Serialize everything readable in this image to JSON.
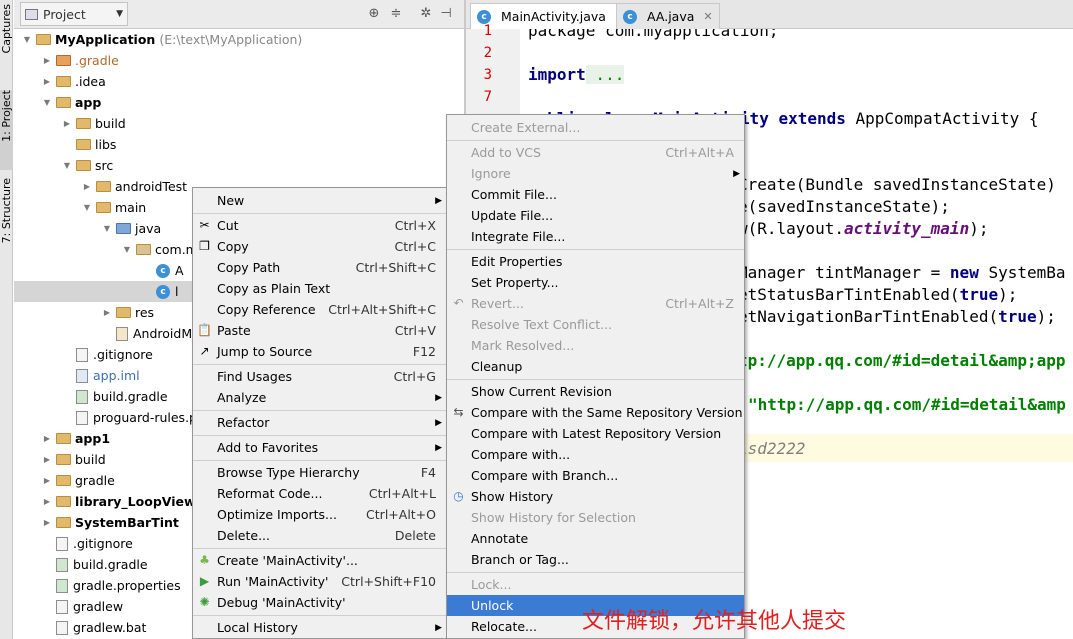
{
  "side_tabs": {
    "captures": "Captures",
    "project": "1: Project",
    "structure": "7: Structure"
  },
  "project_panel": {
    "dropdown_label": "Project"
  },
  "tree": [
    {
      "label": "MyApplication",
      "extra": "(E:\\text\\MyApplication)",
      "depth": 0,
      "arrow": "down",
      "icon": "module",
      "bold": true
    },
    {
      "label": ".gradle",
      "depth": 1,
      "arrow": "right",
      "icon": "folder-red"
    },
    {
      "label": ".idea",
      "depth": 1,
      "arrow": "right",
      "icon": "folder"
    },
    {
      "label": "app",
      "depth": 1,
      "arrow": "down",
      "icon": "module",
      "bold": true
    },
    {
      "label": "build",
      "depth": 2,
      "arrow": "right",
      "icon": "folder"
    },
    {
      "label": "libs",
      "depth": 2,
      "arrow": "",
      "icon": "folder"
    },
    {
      "label": "src",
      "depth": 2,
      "arrow": "down",
      "icon": "folder"
    },
    {
      "label": "androidTest",
      "depth": 3,
      "arrow": "right",
      "icon": "folder"
    },
    {
      "label": "main",
      "depth": 3,
      "arrow": "down",
      "icon": "folder"
    },
    {
      "label": "java",
      "depth": 4,
      "arrow": "down",
      "icon": "folder-src"
    },
    {
      "label": "com.m",
      "depth": 5,
      "arrow": "down",
      "icon": "package"
    },
    {
      "label": "A",
      "depth": 6,
      "arrow": "",
      "icon": "class"
    },
    {
      "label": "l",
      "depth": 6,
      "arrow": "",
      "icon": "class",
      "selected": true
    },
    {
      "label": "res",
      "depth": 4,
      "arrow": "right",
      "icon": "folder-res"
    },
    {
      "label": "AndroidM",
      "depth": 4,
      "arrow": "",
      "icon": "manifest"
    },
    {
      "label": ".gitignore",
      "depth": 2,
      "arrow": "",
      "icon": "file"
    },
    {
      "label": "app.iml",
      "depth": 2,
      "arrow": "",
      "icon": "iml",
      "muted": true
    },
    {
      "label": "build.gradle",
      "depth": 2,
      "arrow": "",
      "icon": "gradle"
    },
    {
      "label": "proguard-rules.p",
      "depth": 2,
      "arrow": "",
      "icon": "file"
    },
    {
      "label": "app1",
      "depth": 1,
      "arrow": "right",
      "icon": "module",
      "bold": true
    },
    {
      "label": "build",
      "depth": 1,
      "arrow": "right",
      "icon": "folder"
    },
    {
      "label": "gradle",
      "depth": 1,
      "arrow": "right",
      "icon": "folder"
    },
    {
      "label": "library_LoopView",
      "depth": 1,
      "arrow": "right",
      "icon": "module",
      "bold": true
    },
    {
      "label": "SystemBarTint",
      "depth": 1,
      "arrow": "right",
      "icon": "module",
      "bold": true
    },
    {
      "label": ".gitignore",
      "depth": 1,
      "arrow": "",
      "icon": "file"
    },
    {
      "label": "build.gradle",
      "depth": 1,
      "arrow": "",
      "icon": "gradle"
    },
    {
      "label": "gradle.properties",
      "depth": 1,
      "arrow": "",
      "icon": "gradle"
    },
    {
      "label": "gradlew",
      "depth": 1,
      "arrow": "",
      "icon": "file"
    },
    {
      "label": "gradlew.bat",
      "depth": 1,
      "arrow": "",
      "icon": "file"
    }
  ],
  "editor_tabs": [
    {
      "label": "MainActivity.java",
      "active": true
    },
    {
      "label": "AA.java",
      "active": false
    }
  ],
  "line_numbers": [
    "1",
    "2",
    "3",
    "7"
  ],
  "code": {
    "l1": "package com.myapplication;",
    "l3a": "import",
    "l3b": " ...",
    "l7a": "public class MainActivity ",
    "l7b": "extends",
    "l7c": " AppCompatActivity {",
    "c1": "Create(Bundle savedInstanceState)",
    "c2": "e(savedInstanceState);",
    "c3a": "w(R.layout.",
    "c3b": "activity_main",
    "c3c": ");",
    "c4a": "Manager tintManager = ",
    "c4b": "new",
    "c4c": " SystemBa",
    "c5a": "etStatusBarTintEnabled(",
    "c5b": "true",
    "c5c": ");",
    "c6a": "etNavigationBarTintEnabled(",
    "c6b": "true",
    "c6c": ");",
    "c7": "tp://app.qq.com/#id=detail&amp;app",
    "c8": "\"http://app.qq.com/#id=detail&amp",
    "c9": "lsd2222"
  },
  "context_menu": [
    {
      "label": "New",
      "sub": true
    },
    {
      "sep": true
    },
    {
      "label": "Cut",
      "u": "t",
      "sc": "Ctrl+X",
      "icon": "cut-icon"
    },
    {
      "label": "Copy",
      "u": "C",
      "sc": "Ctrl+C",
      "icon": "copy-icon"
    },
    {
      "label": "Copy Path",
      "sc": "Ctrl+Shift+C"
    },
    {
      "label": "Copy as Plain Text"
    },
    {
      "label": "Copy Reference",
      "sc": "Ctrl+Alt+Shift+C"
    },
    {
      "label": "Paste",
      "u": "P",
      "sc": "Ctrl+V",
      "icon": "paste-icon"
    },
    {
      "label": "Jump to Source",
      "sc": "F12",
      "icon": "jump-icon"
    },
    {
      "sep": true
    },
    {
      "label": "Find Usages",
      "sc": "Ctrl+G"
    },
    {
      "label": "Analyze",
      "sub": true
    },
    {
      "sep": true
    },
    {
      "label": "Refactor",
      "sub": true
    },
    {
      "sep": true
    },
    {
      "label": "Add to Favorites",
      "sub": true
    },
    {
      "sep": true
    },
    {
      "label": "Browse Type Hierarchy",
      "sc": "F4"
    },
    {
      "label": "Reformat Code...",
      "sc": "Ctrl+Alt+L"
    },
    {
      "label": "Optimize Imports...",
      "sc": "Ctrl+Alt+O"
    },
    {
      "label": "Delete...",
      "sc": "Delete"
    },
    {
      "sep": true
    },
    {
      "label": "Create 'MainActivity'...",
      "icon": "android-icon"
    },
    {
      "label": "Run 'MainActivity'",
      "sc": "Ctrl+Shift+F10",
      "icon": "run-icon"
    },
    {
      "label": "Debug 'MainActivity'",
      "icon": "debug-icon"
    },
    {
      "sep": true
    },
    {
      "label": "Local History",
      "sub": true
    }
  ],
  "svn_menu": [
    {
      "label": "Create External...",
      "dis": true
    },
    {
      "sep": true
    },
    {
      "label": "Add to VCS",
      "sc": "Ctrl+Alt+A",
      "dis": true
    },
    {
      "label": "Ignore",
      "dis": true,
      "sub": true
    },
    {
      "label": "Commit File..."
    },
    {
      "label": "Update File..."
    },
    {
      "label": "Integrate File..."
    },
    {
      "sep": true
    },
    {
      "label": "Edit Properties"
    },
    {
      "label": "Set Property..."
    },
    {
      "label": "Revert...",
      "sc": "Ctrl+Alt+Z",
      "dis": true,
      "icon": "revert-icon"
    },
    {
      "label": "Resolve Text Conflict...",
      "dis": true
    },
    {
      "label": "Mark Resolved...",
      "dis": true
    },
    {
      "label": "Cleanup"
    },
    {
      "sep": true
    },
    {
      "label": "Show Current Revision"
    },
    {
      "label": "Compare with the Same Repository Version",
      "icon": "compare-icon"
    },
    {
      "label": "Compare with Latest Repository Version"
    },
    {
      "label": "Compare with..."
    },
    {
      "label": "Compare with Branch..."
    },
    {
      "label": "Show History",
      "icon": "history-icon"
    },
    {
      "label": "Show History for Selection",
      "dis": true
    },
    {
      "label": "Annotate"
    },
    {
      "label": "Branch or Tag..."
    },
    {
      "sep": true
    },
    {
      "label": "Lock...",
      "dis": true
    },
    {
      "label": "Unlock",
      "hover": true
    },
    {
      "label": "Relocate..."
    }
  ],
  "annotation": "文件解锁，允许其他人提交",
  "colors": {
    "menu_highlight": "#3b7bd4",
    "annotation_red": "#e02020"
  }
}
